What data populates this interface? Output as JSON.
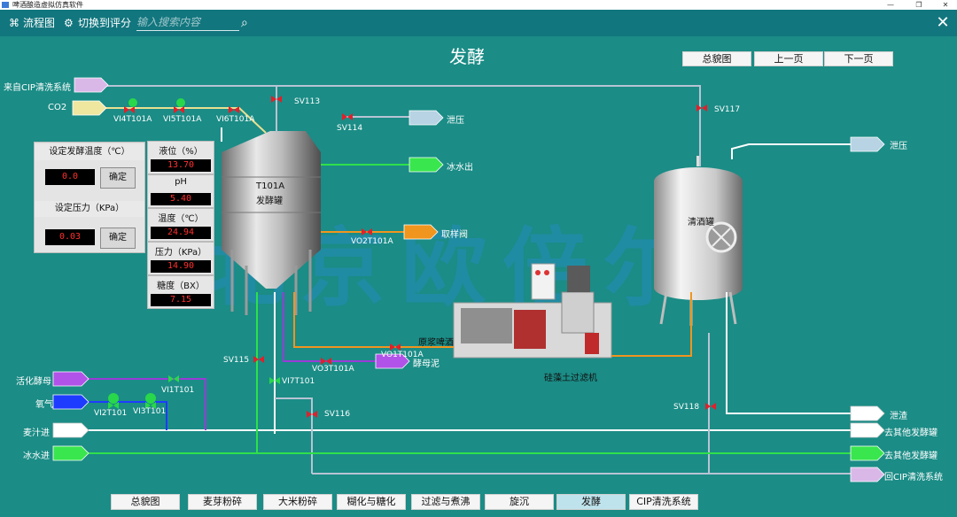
{
  "window": {
    "title": "啤酒酿造虚拟仿真软件",
    "min_icon": "minimize-icon",
    "max_icon": "maximize-icon",
    "close_icon": "close-icon"
  },
  "toolbar": {
    "flow_label": "流程图",
    "switch_label": "切换到评分",
    "search_placeholder": "输入搜索内容",
    "search_icon": "search-icon",
    "flow_icon": "flowchart-icon",
    "switch_icon": "score-icon"
  },
  "page": {
    "title": "发酵"
  },
  "top_nav": {
    "overview": "总貌图",
    "prev": "上一页",
    "next": "下一页"
  },
  "bottom_tabs": [
    {
      "label": "总貌图",
      "active": false
    },
    {
      "label": "麦芽粉碎",
      "active": false
    },
    {
      "label": "大米粉碎",
      "active": false
    },
    {
      "label": "糊化与糖化",
      "active": false
    },
    {
      "label": "过滤与煮沸",
      "active": false
    },
    {
      "label": "旋沉",
      "active": false
    },
    {
      "label": "发酵",
      "active": true
    },
    {
      "label": "CIP清洗系统",
      "active": false
    }
  ],
  "control_panel": {
    "set_temp_label": "设定发酵温度（℃）",
    "set_temp_value": "0.0",
    "set_pressure_label": "设定压力（KPa）",
    "set_pressure_value": "0.03",
    "confirm_label": "确定"
  },
  "measurements": [
    {
      "label": "液位（%）",
      "value": "13.70"
    },
    {
      "label": "pH",
      "value": "5.40"
    },
    {
      "label": "温度（℃）",
      "value": "24.94"
    },
    {
      "label": "压力（KPa）",
      "value": "14.90"
    },
    {
      "label": "糖度（BX）",
      "value": "7.15"
    }
  ],
  "equipment": {
    "tank_id": "T101A",
    "tank_name": "发酵罐",
    "bright_tank": "清酒罐",
    "filter": "硅藻土过滤机",
    "raw_beer": "原浆啤酒"
  },
  "streams": {
    "cip_in": "来自CIP清洗系统",
    "co2": "CO2",
    "relief_1": "泄压",
    "relief_2": "泄压",
    "ice_water_out": "冰水出",
    "sample_valve": "取样阀",
    "yeast_mud": "酵母泥",
    "activated_yeast": "活化酵母",
    "oxygen": "氧气",
    "wort_in": "麦汁进",
    "ice_water_in": "冰水进",
    "slag": "泄渣",
    "to_other_1": "去其他发酵罐",
    "to_other_2": "去其他发酵罐",
    "back_cip": "回CIP清洗系统"
  },
  "valves": {
    "sv113": "SV113",
    "sv114": "SV114",
    "sv117": "SV117",
    "sv115": "SV115",
    "sv116": "SV116",
    "sv118": "SV118",
    "vi4": "VI4T101A",
    "vi5": "VI5T101A",
    "vi6": "VI6T101A",
    "vo2": "VO2T101A",
    "vo1": "VO1T101A",
    "vo3": "VO3T101A",
    "vi7": "VI7T101",
    "vi1": "VI1T101",
    "vi2": "VI2T101",
    "vi3": "VI3T101"
  },
  "watermark": "北京欧倍尔",
  "colors": {
    "background": "#1b8c86",
    "toolbar": "#12767e",
    "line_white": "#ffffff",
    "line_green": "#2ee04a",
    "line_purple": "#9a3bd8",
    "line_blue": "#1e3cff",
    "line_orange": "#f0951e",
    "line_gray": "#b7c4d4",
    "valve_red": "#e0202a",
    "valve_green": "#28d84a"
  }
}
